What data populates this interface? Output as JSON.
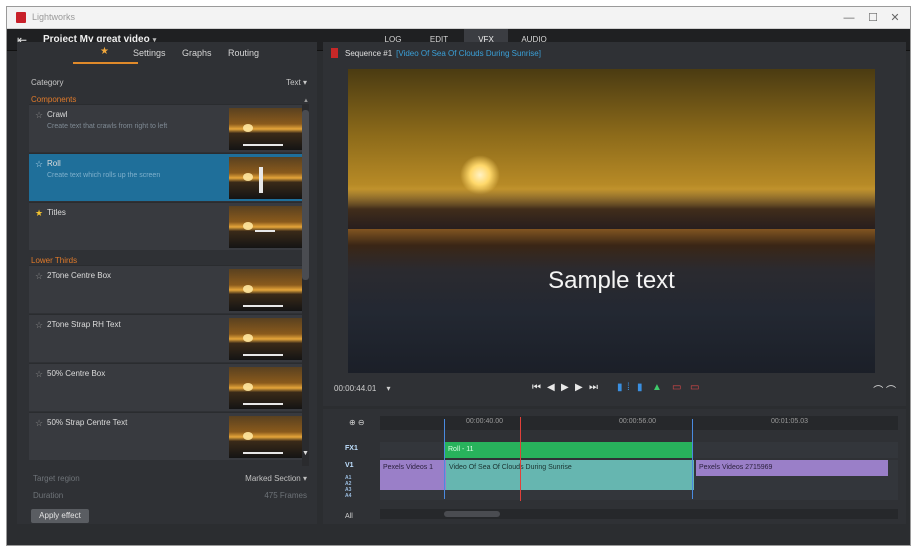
{
  "window": {
    "app_title": "Lightworks",
    "minimize_icon": "minimize-icon",
    "maximize_icon": "maximize-icon",
    "close_icon": "close-icon"
  },
  "menubar": {
    "project_title": "Project My great video",
    "project_caret": "▾",
    "tabs": [
      {
        "label": "LOG",
        "active": false
      },
      {
        "label": "EDIT",
        "active": false
      },
      {
        "label": "VFX",
        "active": true
      },
      {
        "label": "AUDIO",
        "active": false
      }
    ]
  },
  "effects_panel": {
    "tabs": {
      "favorites": "★",
      "settings": "Settings",
      "graphs": "Graphs",
      "routing": "Routing"
    },
    "category_label": "Category",
    "category_value": "Text ▾",
    "sections": {
      "components": "Components",
      "lower_thirds": "Lower Thirds"
    },
    "items_components": [
      {
        "name": "Crawl",
        "description": "Create text that crawls from right to left",
        "starred": false,
        "selected": false
      },
      {
        "name": "Roll",
        "description": "Create text which rolls up the screen",
        "starred": false,
        "selected": true
      },
      {
        "name": "Titles",
        "description": "",
        "starred": true,
        "selected": false
      }
    ],
    "items_lower_thirds": [
      {
        "name": "2Tone Centre Box",
        "starred": false
      },
      {
        "name": "2Tone Strap RH Text",
        "starred": false
      },
      {
        "name": "50% Centre Box",
        "starred": false
      },
      {
        "name": "50% Strap Centre Text",
        "starred": false
      }
    ],
    "target_region_label": "Target region",
    "target_region_value": "Marked Section ▾",
    "duration_label": "Duration",
    "duration_value": "475 Frames",
    "apply_button": "Apply effect"
  },
  "viewer": {
    "sequence_title": "Sequence #1",
    "sequence_subtitle": "[Video Of Sea Of Clouds During Sunrise]",
    "overlay_text": "Sample text",
    "timecode": "00:00:44.01",
    "timecode_caret": "▾",
    "transport": [
      "⏮",
      "◀",
      "▶",
      "▶",
      "⏭"
    ]
  },
  "timeline": {
    "ruler_times": [
      "00:00:40.00",
      "00:00:56.00",
      "00:01:05.03"
    ],
    "tracks": [
      "FX1",
      "V1",
      "A1",
      "A2",
      "A3",
      "A4"
    ],
    "all_label": "All",
    "clips": {
      "fx": "Roll - 11",
      "v1_a": "Pexels Videos 1",
      "v1_b": "Video Of Sea Of Clouds During Sunrise",
      "v1_c": "Pexels Videos 2715969"
    }
  }
}
